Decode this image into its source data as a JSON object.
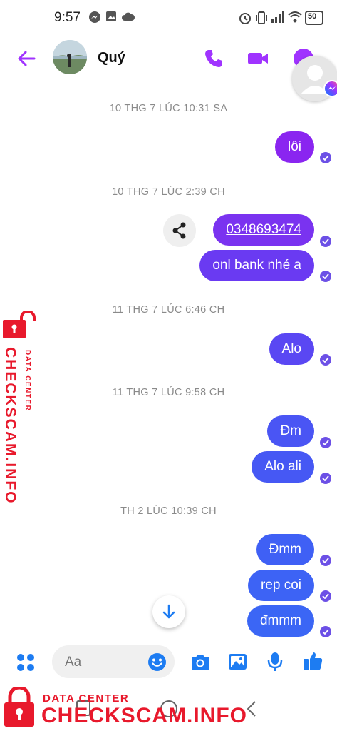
{
  "status_bar": {
    "time": "9:57",
    "battery": "50"
  },
  "header": {
    "contact_name": "Quý",
    "back_icon": "arrow-left-icon",
    "call_icon": "phone-icon",
    "video_icon": "video-camera-icon",
    "info_icon": "info-icon"
  },
  "colors": {
    "accent": "#a033ff",
    "bubble_purple": "#8a25f0",
    "bubble_violet": "#6a3af2",
    "bubble_blue": "#3d5cf5",
    "watermark_red": "#e8192c"
  },
  "thread": {
    "items": [
      {
        "kind": "timestamp",
        "text": "10 THG 7 LÚC 10:31 SA"
      },
      {
        "kind": "message",
        "text": "lôi",
        "color": "#8a25f0"
      },
      {
        "kind": "timestamp",
        "text": "10 THG 7 LÚC 2:39 CH"
      },
      {
        "kind": "message",
        "text": "0348693474",
        "color": "#7a33f0",
        "is_link": true
      },
      {
        "kind": "message",
        "text": "onl bank nhé a",
        "color": "#6a3af2"
      },
      {
        "kind": "timestamp",
        "text": "11 THG 7 LÚC 6:46 CH"
      },
      {
        "kind": "message",
        "text": "Alo",
        "color": "#5a47f3"
      },
      {
        "kind": "timestamp",
        "text": "11 THG 7 LÚC 9:58 CH"
      },
      {
        "kind": "message",
        "text": "Đm",
        "color": "#4a55f4"
      },
      {
        "kind": "message",
        "text": "Alo ali",
        "color": "#4658f4"
      },
      {
        "kind": "timestamp",
        "text": "TH 2 LÚC 10:39 CH"
      },
      {
        "kind": "message",
        "text": "Đmm",
        "color": "#3f60f5"
      },
      {
        "kind": "message",
        "text": "rep coi",
        "color": "#3d63f5"
      },
      {
        "kind": "message",
        "text": "đmmm",
        "color": "#3b66f5"
      }
    ]
  },
  "composer": {
    "placeholder": "Aa",
    "icons": [
      "apps-grid-icon",
      "emoji-icon",
      "camera-icon",
      "image-icon",
      "microphone-icon",
      "thumbs-up-icon"
    ]
  },
  "watermark": {
    "small": "DATA CENTER",
    "big": "CHECKSCAM.INFO"
  }
}
